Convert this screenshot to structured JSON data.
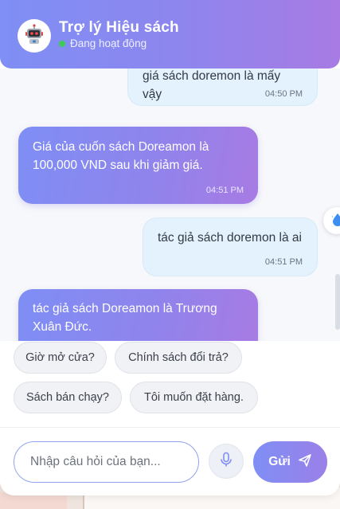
{
  "header": {
    "title": "Trợ lý Hiệu sách",
    "status": "Đang hoạt động",
    "status_color": "#3ccb5b",
    "avatar_icon": "robot-icon",
    "gradient": [
      "#7f8ff5",
      "#a77be3"
    ]
  },
  "messages": [
    {
      "sender": "user",
      "text": "giá sách doremon là mấy vậy",
      "time": "04:50 PM"
    },
    {
      "sender": "bot",
      "text": "Giá của cuốn sách Doreamon là 100,000 VND sau khi giảm giá.",
      "time": "04:51 PM"
    },
    {
      "sender": "user",
      "text": "tác giả sách doremon là ai",
      "time": "04:51 PM"
    },
    {
      "sender": "bot",
      "text": "tác giả sách Doreamon là Trương Xuân Đức.",
      "time": ""
    }
  ],
  "suggestions": [
    "Giờ mở cửa?",
    "Chính sách đổi trả?",
    "Sách bán chạy?",
    "Tôi muốn đặt hàng."
  ],
  "input": {
    "placeholder": "Nhập câu hỏi của bạn...",
    "value": ""
  },
  "mic_icon": "microphone-icon",
  "send": {
    "label": "Gửi",
    "icon": "send-arrow-icon"
  },
  "colors": {
    "user_bubble": "#e3f2fd",
    "accent": "#8c86ee"
  }
}
